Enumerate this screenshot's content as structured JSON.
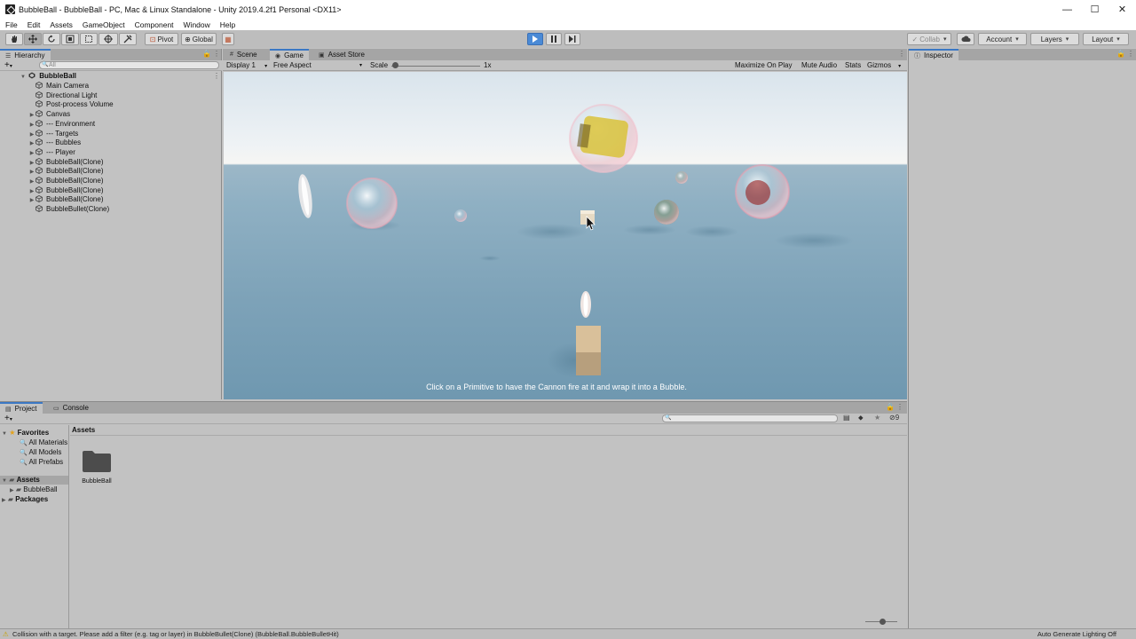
{
  "window": {
    "title": "BubbleBall - BubbleBall - PC, Mac & Linux Standalone - Unity 2019.4.2f1 Personal <DX11>",
    "controls": [
      "—",
      "☐",
      "✕"
    ]
  },
  "menu": [
    "File",
    "Edit",
    "Assets",
    "GameObject",
    "Component",
    "Window",
    "Help"
  ],
  "toolbar": {
    "pivot_label": "Pivot",
    "global_label": "Global",
    "collab_label": "Collab",
    "account_label": "Account",
    "layers_label": "Layers",
    "layout_label": "Layout",
    "play_state": "playing"
  },
  "hierarchy": {
    "tab_label": "Hierarchy",
    "add_label": "+",
    "search_placeholder": "All",
    "scene_name": "BubbleBall",
    "items": [
      {
        "label": "Main Camera",
        "expandable": false
      },
      {
        "label": "Directional Light",
        "expandable": false
      },
      {
        "label": "Post-process Volume",
        "expandable": false
      },
      {
        "label": "Canvas",
        "expandable": true
      },
      {
        "label": "--- Environment",
        "expandable": true
      },
      {
        "label": "--- Targets",
        "expandable": true
      },
      {
        "label": "--- Bubbles",
        "expandable": true
      },
      {
        "label": "--- Player",
        "expandable": true
      },
      {
        "label": "BubbleBall(Clone)",
        "expandable": true
      },
      {
        "label": "BubbleBall(Clone)",
        "expandable": true
      },
      {
        "label": "BubbleBall(Clone)",
        "expandable": true
      },
      {
        "label": "BubbleBall(Clone)",
        "expandable": true
      },
      {
        "label": "BubbleBall(Clone)",
        "expandable": true
      },
      {
        "label": "BubbleBullet(Clone)",
        "expandable": false
      }
    ]
  },
  "center_tabs": [
    {
      "label": "Scene",
      "icon": "#"
    },
    {
      "label": "Game",
      "icon": "◉"
    },
    {
      "label": "Asset Store",
      "icon": "▣"
    }
  ],
  "game_toolbar": {
    "display": "Display 1",
    "aspect": "Free Aspect",
    "scale_label": "Scale",
    "scale_value": "1x",
    "maximize_on_play": "Maximize On Play",
    "mute_audio": "Mute Audio",
    "stats": "Stats",
    "gizmos": "Gizmos"
  },
  "game_view": {
    "hint": "Click on a Primitive to have the Cannon fire at it and wrap it into a Bubble."
  },
  "inspector": {
    "tab_label": "Inspector"
  },
  "project": {
    "tabs": [
      {
        "label": "Project",
        "icon": "▤"
      },
      {
        "label": "Console",
        "icon": "▭"
      }
    ],
    "add_label": "+",
    "hidden_count": "9",
    "tree": {
      "favorites_label": "Favorites",
      "favorites": [
        "All Materials",
        "All Models",
        "All Prefabs"
      ],
      "assets_label": "Assets",
      "assets_children": [
        "BubbleBall"
      ],
      "packages_label": "Packages"
    },
    "breadcrumb": "Assets",
    "grid_items": [
      {
        "label": "BubbleBall",
        "icon": "folder-icon"
      }
    ]
  },
  "status": {
    "message": "Collision with a target. Please add a filter (e.g. tag or layer) in BubbleBullet(Clone) (BubbleBall.BubbleBulletHit)",
    "right": "Auto Generate Lighting Off"
  },
  "colors": {
    "accent": "#3b78c4",
    "play_active": "#4a8ad6",
    "panel_bg": "#c2c2c2",
    "tab_bg": "#a5a5a5"
  }
}
